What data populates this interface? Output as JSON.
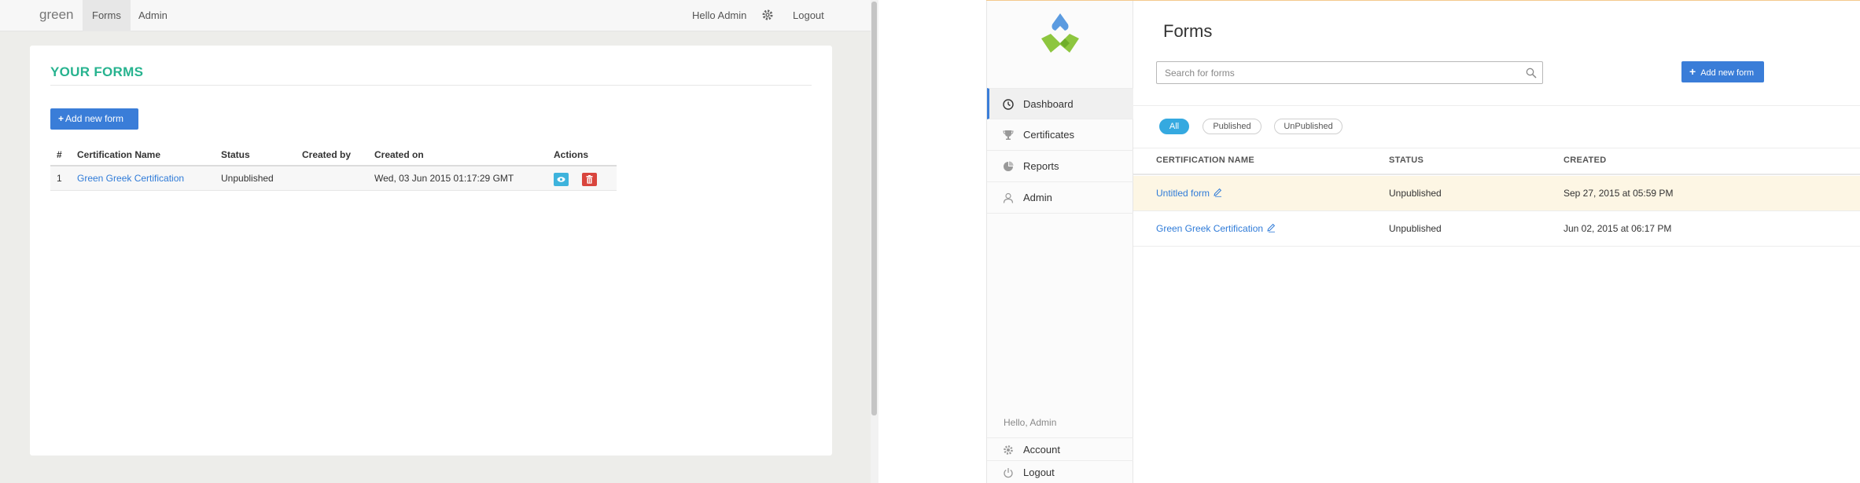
{
  "left": {
    "brand": "green",
    "nav": {
      "forms": "Forms",
      "admin": "Admin"
    },
    "user": {
      "greeting": "Hello Admin",
      "logout": "Logout"
    },
    "heading": "YOUR FORMS",
    "add_button": "Add new form",
    "table": {
      "headers": [
        "#",
        "Certification Name",
        "Status",
        "Created by",
        "Created on",
        "Actions"
      ],
      "rows": [
        {
          "num": "1",
          "name": "Green Greek Certification",
          "status": "Unpublished",
          "created_by": "",
          "created_on": "Wed, 03 Jun 2015 01:17:29 GMT"
        }
      ]
    },
    "colors": {
      "heading": "#27b38f",
      "primary": "#3a7dd8",
      "view": "#3eb3dc",
      "delete": "#d9453d"
    }
  },
  "right": {
    "sidebar": {
      "items": [
        {
          "label": "Dashboard",
          "icon": "dashboard-icon",
          "active": true
        },
        {
          "label": "Certificates",
          "icon": "trophy-icon"
        },
        {
          "label": "Reports",
          "icon": "pie-chart-icon"
        },
        {
          "label": "Admin",
          "icon": "users-icon"
        }
      ],
      "greeting": "Hello, Admin",
      "account": "Account",
      "logout": "Logout"
    },
    "main": {
      "title": "Forms",
      "search_placeholder": "Search for forms",
      "add_button": "Add new form",
      "filters": [
        "All",
        "Published",
        "UnPublished"
      ],
      "headers": [
        "CERTIFICATION NAME",
        "STATUS",
        "CREATED"
      ],
      "rows": [
        {
          "name": "Untitled form",
          "status": "Unpublished",
          "created": "Sep 27, 2015 at 05:59 PM",
          "highlighted": true
        },
        {
          "name": "Green Greek Certification",
          "status": "Unpublished",
          "created": "Jun 02, 2015 at 06:17 PM"
        }
      ]
    },
    "colors": {
      "accent": "#35a9e0",
      "primary": "#3a7dd8",
      "row_highlight": "#fdf6e4",
      "logo_blue": "#5b9be0",
      "logo_green": "#8dc63f"
    }
  }
}
